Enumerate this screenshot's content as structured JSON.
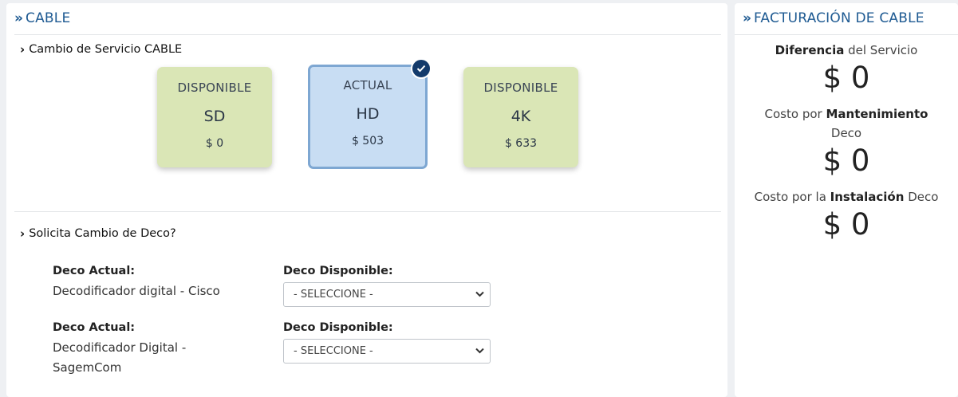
{
  "cable_panel": {
    "title": "CABLE",
    "service_change": {
      "title": "Cambio de Servicio CABLE",
      "plans": [
        {
          "status": "DISPONIBLE",
          "name": "SD",
          "price": "$ 0"
        },
        {
          "status": "ACTUAL",
          "name": "HD",
          "price": "$ 503"
        },
        {
          "status": "DISPONIBLE",
          "name": "4K",
          "price": "$ 633"
        }
      ]
    },
    "deco_change": {
      "title": "Solicita Cambio de Deco?",
      "rows": [
        {
          "current_label": "Deco Actual:",
          "current_value_lines": [
            "Decodificador digital - Cisco"
          ],
          "available_label": "Deco Disponible:",
          "select_value": "- SELECCIONE -"
        },
        {
          "current_label": "Deco Actual:",
          "current_value_lines": [
            "Decodificador Digital -",
            "SagemCom"
          ],
          "available_label": "Deco Disponible:",
          "select_value": "- SELECCIONE -"
        }
      ]
    }
  },
  "billing_panel": {
    "title": "FACTURACIÓN DE CABLE",
    "items": [
      {
        "bold": "Diferencia",
        "line1_rest": " del Servicio",
        "amount": "$ 0"
      },
      {
        "line1_pre": "Costo por ",
        "bold": "Mantenimiento",
        "line2": "Deco",
        "amount": "$ 0"
      },
      {
        "line1_pre": "Costo por la ",
        "bold": "Instalación",
        "line1_rest": " Deco",
        "amount": "$ 0"
      }
    ]
  },
  "colors": {
    "title_blue": "#1e5a92",
    "available_card": "#dae6b6",
    "current_card": "#c8ddf3",
    "check_badge": "#133a6b"
  }
}
